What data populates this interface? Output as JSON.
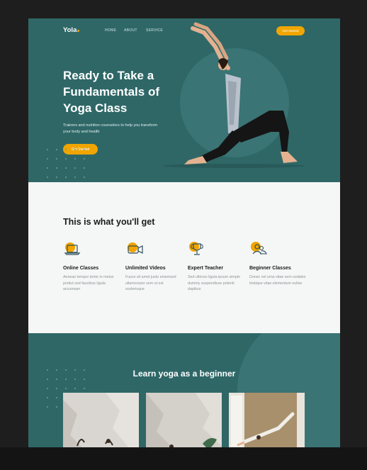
{
  "header": {
    "logo": "Yola",
    "nav": [
      "HOME",
      "ABOUT",
      "SERVICE"
    ],
    "cta_label": "Get Started"
  },
  "hero": {
    "title": "Ready to Take a Fundamentals of Yoga Class",
    "subtitle": "Trainers and nutrition counselors to help you transform your body and health",
    "cta_label": "Get Started"
  },
  "features": {
    "title": "This is what you'll get",
    "items": [
      {
        "name": "Online Classes",
        "icon": "laptop-icon",
        "desc": "Aenean tempor tortor in metus pretiut sed faucibus ligula accumsan"
      },
      {
        "name": "Unlimited Videos",
        "icon": "video-camera-icon",
        "desc": "Fusce sit amet justo eniemsed ullamcorper sem ut est scelerisque"
      },
      {
        "name": "Expert Teacher",
        "icon": "trophy-icon",
        "desc": "Sed ultrices ligula ipsum simple dummy suspendisse potenti dapibus"
      },
      {
        "name": "Beginner Classes",
        "icon": "users-icon",
        "desc": "Donec vel urna vitae sem sodales tristique vitae elementum nullan"
      }
    ]
  },
  "learn": {
    "title": "Learn yoga as a beginner"
  },
  "colors": {
    "teal": "#2f6767",
    "accent": "#f0a500",
    "light_bg": "#f5f6f6",
    "dark_frame": "#1e1e1e"
  }
}
